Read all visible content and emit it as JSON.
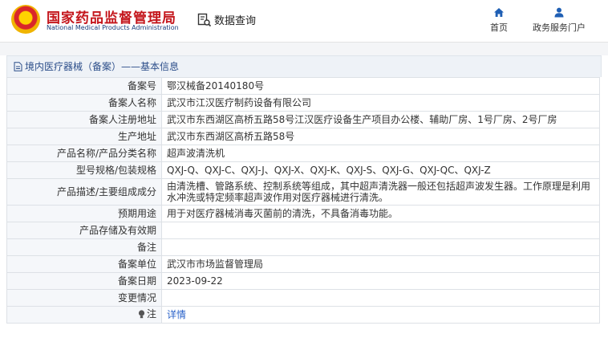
{
  "header": {
    "logo_cn": "国家药品监督管理局",
    "logo_en": "National Medical Products Administration",
    "query_link": "数据查询",
    "nav": [
      {
        "label": "首页",
        "icon": "home-icon"
      },
      {
        "label": "政务服务门户",
        "icon": "user-icon"
      }
    ]
  },
  "breadcrumb": {
    "icon": "document-icon",
    "text": "境内医疗器械（备案）——基本信息"
  },
  "details": {
    "rows": [
      {
        "key": "备案号",
        "value": "鄂汉械备20140180号"
      },
      {
        "key": "备案人名称",
        "value": "武汉市江汉医疗制药设备有限公司"
      },
      {
        "key": "备案人注册地址",
        "value": "武汉市东西湖区高桥五路58号江汉医疗设备生产项目办公楼、辅助厂房、1号厂房、2号厂房"
      },
      {
        "key": "生产地址",
        "value": "武汉市东西湖区高桥五路58号"
      },
      {
        "key": "产品名称/产品分类名称",
        "value": "超声波清洗机"
      },
      {
        "key": "型号规格/包装规格",
        "value": "QXJ-Q、QXJ-C、QXJ-J、QXJ-X、QXJ-K、QXJ-S、QXJ-G、QXJ-QC、QXJ-Z"
      },
      {
        "key": "产品描述/主要组成成分",
        "value": "由清洗槽、管路系统、控制系统等组成，其中超声清洗器一般还包括超声波发生器。工作原理是利用水冲洗或特定频率超声波作用对医疗器械进行清洗。"
      },
      {
        "key": "预期用途",
        "value": "用于对医疗器械消毒灭菌前的清洗，不具备消毒功能。"
      },
      {
        "key": "产品存储及有效期",
        "value": ""
      },
      {
        "key": "备注",
        "value": ""
      },
      {
        "key": "备案单位",
        "value": "武汉市市场监督管理局"
      },
      {
        "key": "备案日期",
        "value": "2023-09-22"
      },
      {
        "key": "变更情况",
        "value": ""
      }
    ],
    "note_row": {
      "key": "注",
      "icon": "lightbulb-icon",
      "link": "详情"
    }
  }
}
